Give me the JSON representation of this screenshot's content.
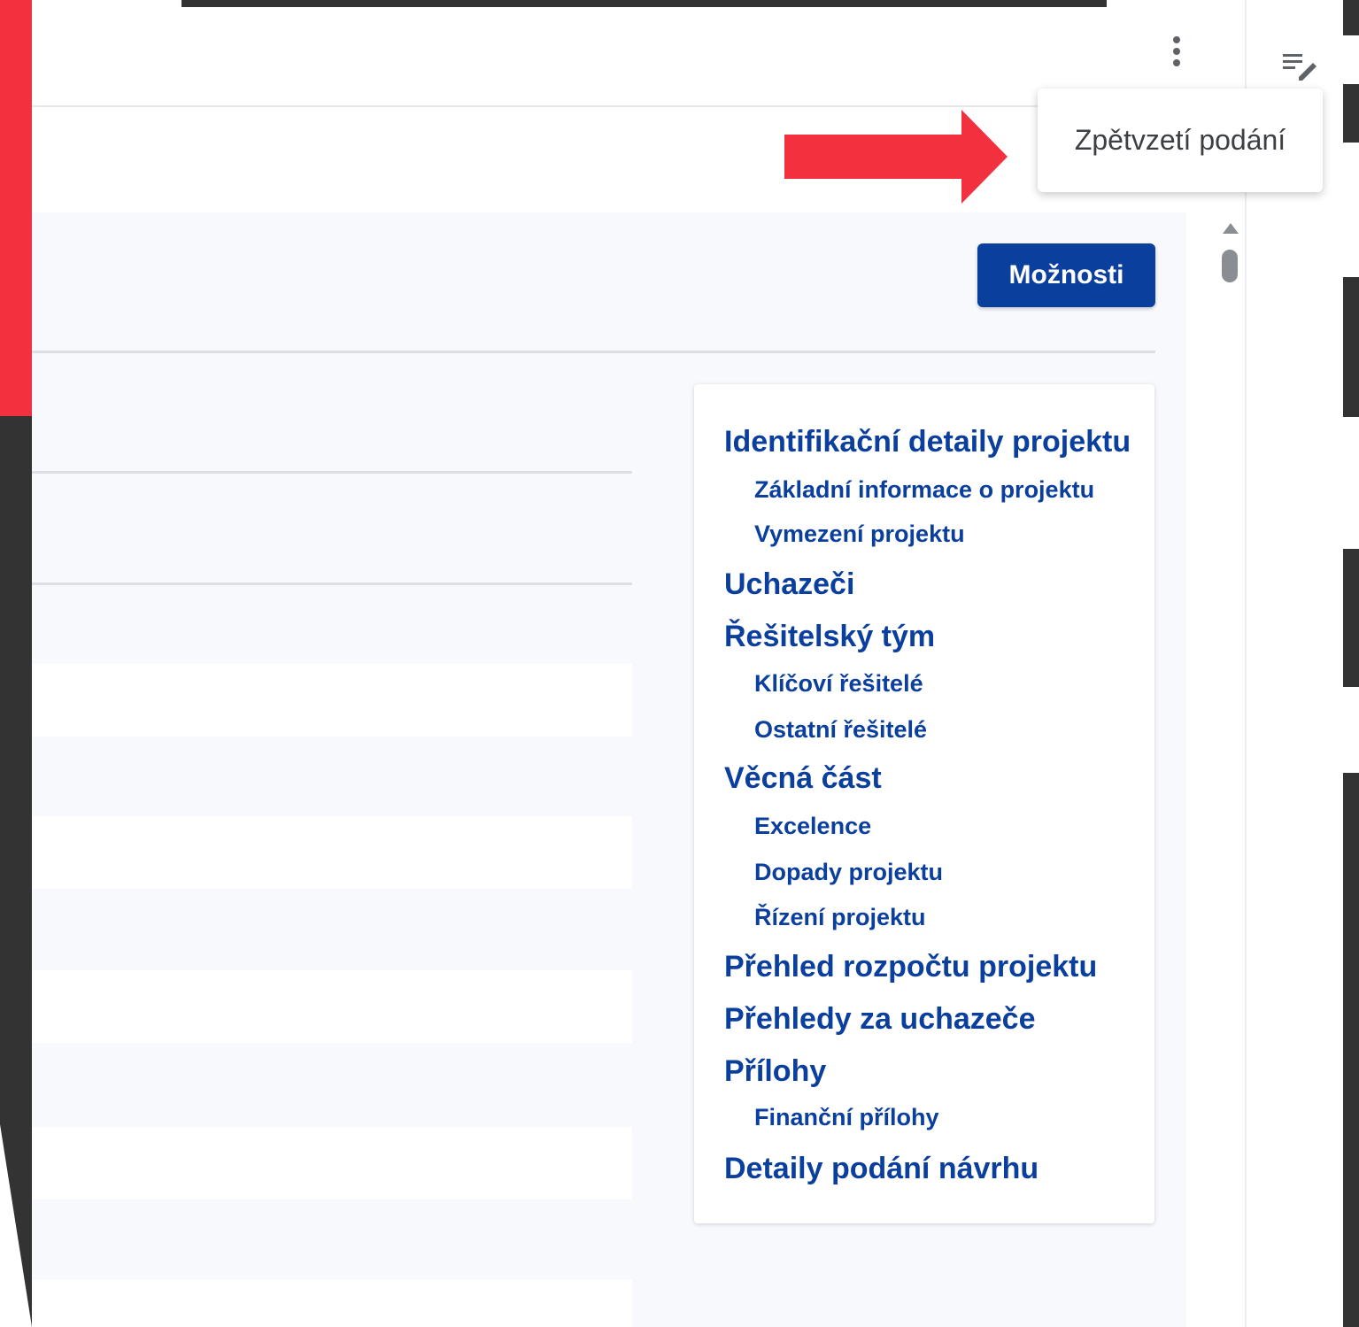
{
  "menu": {
    "more_icon": "more-vert-icon",
    "edit_icon": "edit-notes-icon",
    "dropdown_item": "Zpětvzetí podání"
  },
  "toolbar": {
    "options_label": "Možnosti"
  },
  "toc": {
    "items": [
      {
        "label": "Identifikační detaily projektu",
        "level": 1
      },
      {
        "label": "Základní informace o projektu",
        "level": 2
      },
      {
        "label": "Vymezení projektu",
        "level": 2
      },
      {
        "label": "Uchazeči",
        "level": 1
      },
      {
        "label": "Řešitelský tým",
        "level": 1
      },
      {
        "label": "Klíčoví řešitelé",
        "level": 2
      },
      {
        "label": "Ostatní řešitelé",
        "level": 2
      },
      {
        "label": "Věcná část",
        "level": 1
      },
      {
        "label": "Excelence",
        "level": 2
      },
      {
        "label": "Dopady projektu",
        "level": 2
      },
      {
        "label": "Řízení projektu",
        "level": 2
      },
      {
        "label": "Přehled rozpočtu projektu",
        "level": 1
      },
      {
        "label": "Přehledy za uchazeče",
        "level": 1
      },
      {
        "label": "Přílohy",
        "level": 1
      },
      {
        "label": "Finanční přílohy",
        "level": 2
      },
      {
        "label": "Detaily podání návrhu",
        "level": 1
      }
    ]
  },
  "colors": {
    "primary": "#0b3f9e",
    "annotation_arrow": "#f2303e",
    "frame_dark": "#333333"
  }
}
